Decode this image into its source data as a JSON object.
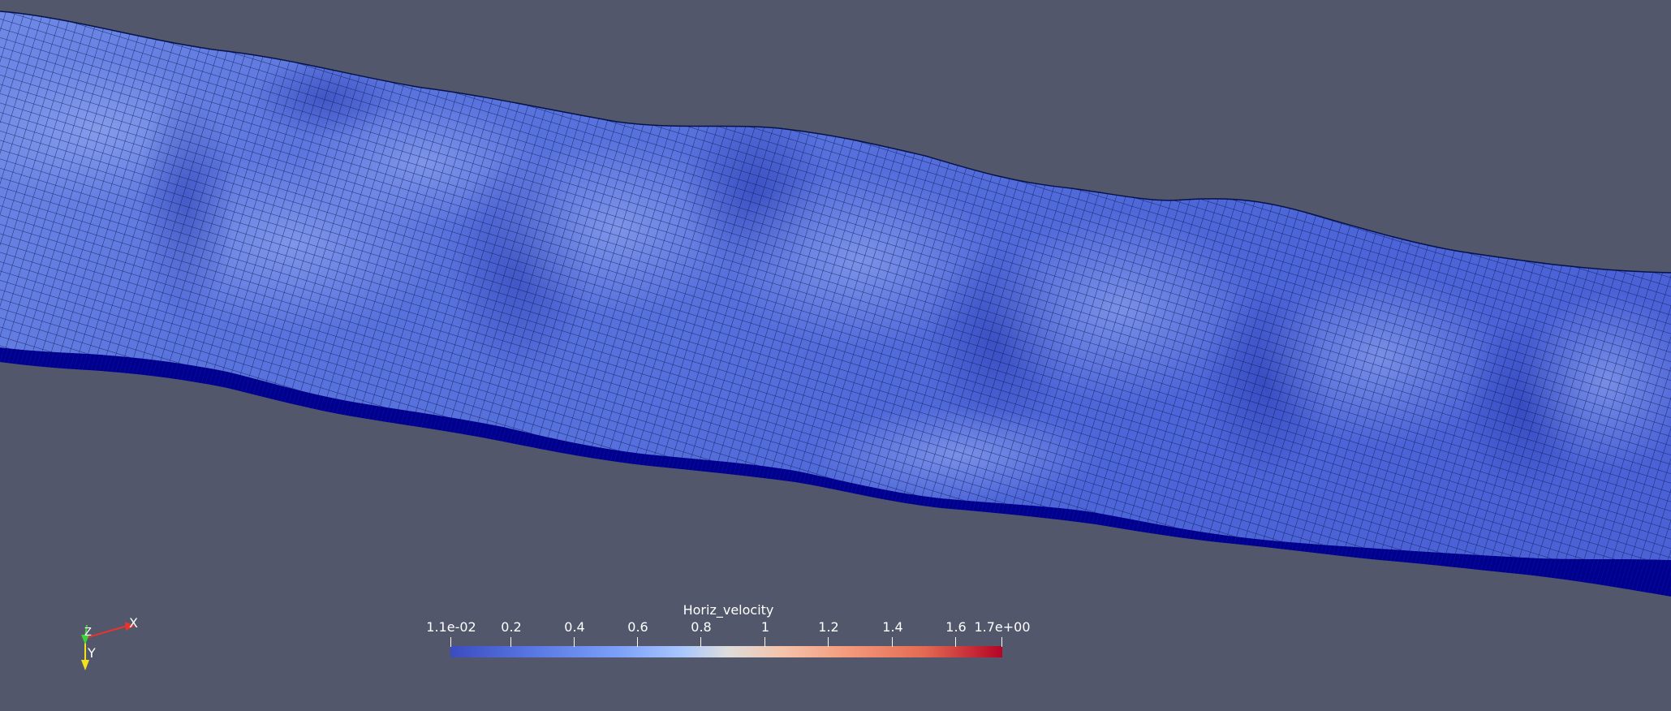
{
  "colorbar": {
    "title": "Horiz_velocity",
    "ticks": [
      "1.1e-02",
      "0.2",
      "0.4",
      "0.6",
      "0.8",
      "1",
      "1.2",
      "1.4",
      "1.6",
      "1.7e+00"
    ],
    "colormap": {
      "low": "#3b4cc0",
      "mid": "#dddddd",
      "high": "#b40426"
    }
  },
  "orientation_axes": {
    "x_label": "X",
    "y_label": "Y",
    "z_label": "Z",
    "x_color": "#e8342b",
    "y_color": "#f5e11b",
    "z_color": "#3fd13a"
  },
  "scene": {
    "background": "#52576b",
    "surface_color": "#4a62d8",
    "wall_color": "#00008f",
    "mesh_line_color": "#06124a"
  }
}
